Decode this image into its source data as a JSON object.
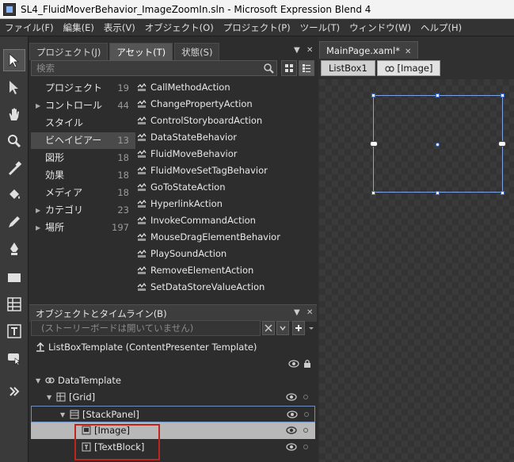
{
  "window": {
    "title": "SL4_FluidMoverBehavior_ImageZoomIn.sln - Microsoft Expression Blend 4"
  },
  "menu": [
    "ファイル(F)",
    "編集(E)",
    "表示(V)",
    "オブジェクト(O)",
    "プロジェクト(P)",
    "ツール(T)",
    "ウィンドウ(W)",
    "ヘルプ(H)"
  ],
  "toolbox": [
    "selection-icon",
    "direct-selection-icon",
    "pan-hand-icon",
    "zoom-icon",
    "eyedropper-icon",
    "paint-bucket-icon",
    "pencil-icon",
    "pen-icon",
    "rectangle-icon",
    "grid-layout-icon",
    "text-icon",
    "pointer-hand-icon",
    "more-tools-icon"
  ],
  "left_panel": {
    "tabs": [
      "プロジェクト(J)",
      "アセット(T)",
      "状態(S)"
    ],
    "active_tab": "アセット(T)",
    "search_placeholder": "検索",
    "categories": [
      {
        "label": "プロジェクト",
        "count": "19",
        "expander": false
      },
      {
        "label": "コントロール",
        "count": "44",
        "expander": true
      },
      {
        "label": "スタイル",
        "count": "",
        "expander": false
      },
      {
        "label": "ビヘイビアー",
        "count": "13",
        "expander": false,
        "selected": true
      },
      {
        "label": "図形",
        "count": "18",
        "expander": false
      },
      {
        "label": "効果",
        "count": "18",
        "expander": false
      },
      {
        "label": "メディア",
        "count": "18",
        "expander": false
      },
      {
        "label": "カテゴリ",
        "count": "23",
        "expander": true
      },
      {
        "label": "場所",
        "count": "197",
        "expander": true
      }
    ],
    "assets": [
      "CallMethodAction",
      "ChangePropertyAction",
      "ControlStoryboardAction",
      "DataStateBehavior",
      "FluidMoveBehavior",
      "FluidMoveSetTagBehavior",
      "GoToStateAction",
      "HyperlinkAction",
      "InvokeCommandAction",
      "MouseDragElementBehavior",
      "PlaySoundAction",
      "RemoveElementAction",
      "SetDataStoreValueAction"
    ]
  },
  "objects_panel": {
    "title": "オブジェクトとタイムライン(B)",
    "storyboard_text": "(ストーリーボードは開いていません)",
    "tree": [
      {
        "label": "ListBoxTemplate (ContentPresenter Template)",
        "depth": 0
      },
      {
        "label": "DataTemplate",
        "depth": 1
      },
      {
        "label": "[Grid]",
        "depth": 2
      },
      {
        "label": "[StackPanel]",
        "depth": 3
      },
      {
        "label": "[Image]",
        "depth": 4
      },
      {
        "label": "[TextBlock]",
        "depth": 4
      }
    ]
  },
  "document": {
    "tab_label": "MainPage.xaml*",
    "breadcrumb": [
      "ListBox1",
      "[Image]"
    ]
  },
  "colors": {
    "selection_blue": "#7fa4e6",
    "highlight_red": "#c0251d",
    "panel_bg": "#2d2d2d"
  }
}
